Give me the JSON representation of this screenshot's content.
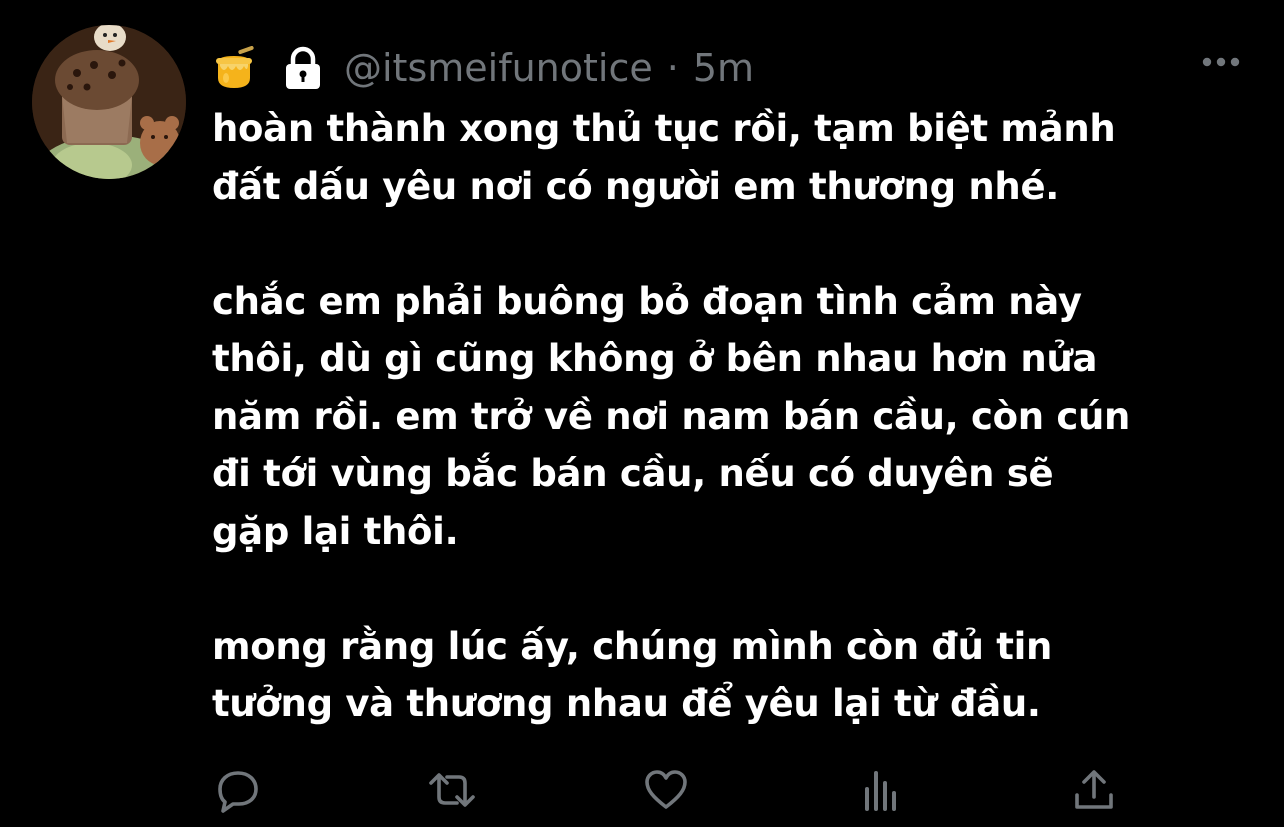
{
  "tweet": {
    "emoji": "honey-pot",
    "handle": "@itsmeifunotice",
    "separator": "·",
    "timestamp": "5m",
    "body": "hoàn thành xong thủ tục rồi, tạm biệt mảnh\nđất dấu yêu nơi có người em thương nhé.\n\nchắc em phải buông bỏ đoạn tình cảm này\nthôi, dù gì cũng không ở bên nhau hơn nửa\nnăm rồi. em trở về nơi nam bán cầu, còn cún\nđi tới vùng bắc bán cầu, nếu có duyên sẽ\ngặp lại thôi.\n\nmong rằng lúc ấy, chúng mình còn đủ tin\ntưởng và thương nhau để yêu lại từ đầu."
  },
  "actions": [
    {
      "name": "reply",
      "icon": "reply-icon"
    },
    {
      "name": "retweet",
      "icon": "retweet-icon"
    },
    {
      "name": "like",
      "icon": "heart-icon"
    },
    {
      "name": "views",
      "icon": "views-icon"
    },
    {
      "name": "share",
      "icon": "share-icon"
    }
  ],
  "colors": {
    "background": "#000000",
    "text": "#ffffff",
    "muted": "#71767b"
  }
}
